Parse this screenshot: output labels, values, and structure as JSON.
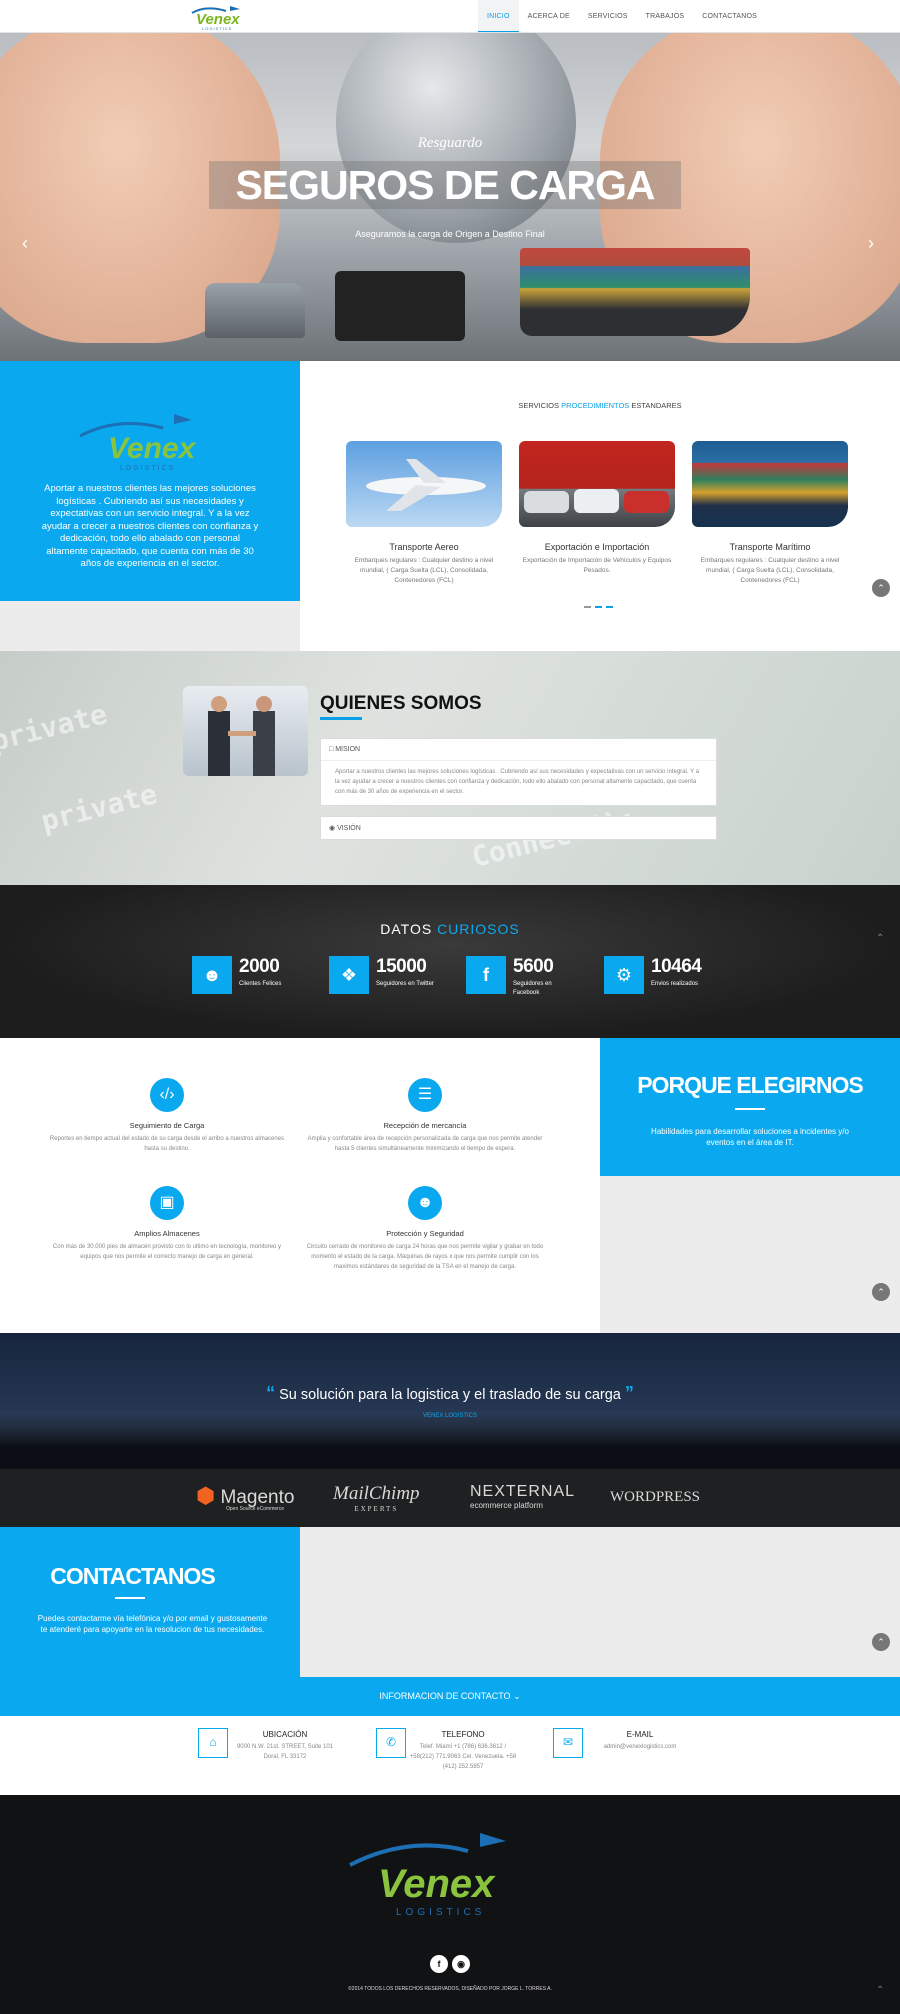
{
  "nav": {
    "logo_text": "Venex",
    "logo_sub": "LOGISTICS",
    "items": [
      "INICIO",
      "ACERCA DE",
      "SERVICIOS",
      "TRABAJOS",
      "CONTACTANOS"
    ]
  },
  "hero": {
    "subtitle": "Resguardo",
    "title": "SEGUROS DE CARGA",
    "caption": "Aseguramos la carga de Origen a Destino Final",
    "prev_icon": "chevron-left-icon",
    "next_icon": "chevron-right-icon"
  },
  "services": {
    "intro": "Aportar a nuestros clientes las mejores soluciones logísticas . Cubriendo así sus necesidades y expectativas con un servicio integral. Y a la vez ayudar a crecer a nuestros clientes con confianza y dedicación, todo ello abalado con personal altamente capacitado, que cuenta con más de 30 años de experiencia en el sector.",
    "heading_pre": "SERVICIOS ",
    "heading_accent": "PROCEDIMIENTOS",
    "heading_post": " ESTANDARES",
    "cards": [
      {
        "title": "Transporte Aereo",
        "desc": "Embarques regulares : Cualquier destino a nivel mundial, ( Carga Suelta (LCL), Consolidada, Contenedores (FCL)"
      },
      {
        "title": "Exportación e Importación",
        "desc": "Exportación de Importación de Vehículos y Equipos Pesados."
      },
      {
        "title": "Transporte Marítimo",
        "desc": "Embarques regulares : Cualquier destino a nivel mundial, ( Carga Suelta (LCL), Consolidada, Contenedores (FCL)"
      }
    ]
  },
  "about": {
    "title": "QUIENES SOMOS",
    "mission_label": "MISION",
    "mission_text": "Aportar a nuestros clientes las mejores soluciones logísticas . Cubriendo así sus necesidades y expectativas con un servicio integral. Y a la vez ayudar a crecer a nuestros clientes con confianza y dedicación, todo ello abalado con personal altamente capacitado, que cuenta con más de 30 años de experiencia en el sector.",
    "vision_label": "VISIÓN"
  },
  "stats": {
    "title_pre": "DATOS ",
    "title_accent": "CURIOSOS",
    "items": [
      {
        "value": "2000",
        "label": "Clientes Felices",
        "icon": "users-icon"
      },
      {
        "value": "15000",
        "label": "Seguidores en Twitter",
        "icon": "twitter-icon"
      },
      {
        "value": "5600",
        "label": "Seguidores en Facebook",
        "icon": "facebook-icon"
      },
      {
        "value": "10464",
        "label": "Envios realizados",
        "icon": "gears-icon"
      }
    ]
  },
  "why": {
    "title": "PORQUE ELEGIRNOS",
    "subtitle": "Habilidades para desarrollar soluciones a incidentes y/o eventos en el área de IT.",
    "features": [
      {
        "title": "Seguimiento de Carga",
        "desc": "Reportes en tiempo actual del estado de su carga desde el arribo a nuestros almacenes hasta su destino.",
        "icon": "code-icon"
      },
      {
        "title": "Recepción de mercancía",
        "desc": "Amplia y confortable área de recepción personalizada de carga que nos permite atender hasta 5 clientes simultáneamente minimizando el tiempo de espera.",
        "icon": "database-icon"
      },
      {
        "title": "Amplios Almacenes",
        "desc": "Con más de 30.000 pies de almacén provisto con lo ultimo en tecnología, monitoreo y equipos que nos permite el correcto manejo de carga en general.",
        "icon": "monitor-icon"
      },
      {
        "title": "Protección y Seguridad",
        "desc": "Circuito cerrado de monitoreo de carga 24 horas que nos permite vigilar y grabar en todo momento el estado de la carga. Máquinas de rayos x que nos permite cumplir con los maximos estándares de seguridad de la TSA en el manejo de carga.",
        "icon": "users-icon"
      }
    ]
  },
  "testimonial": {
    "quote": "Su solución para la logistica y el traslado de su carga",
    "author": "VENEX LOGISTICS"
  },
  "brands": [
    "Magento",
    "Open Source eCommerce",
    "MailChimp",
    "EXPERTS",
    "NEXTERNAL",
    "ecommerce platform",
    "WORDPRESS"
  ],
  "contact": {
    "title": "CONTACTANOS",
    "subtitle": "Puedes contactarme vía telefónica y/o por email y gustosamente te atenderé para apoyarte en la resolucion de tus necesidades.",
    "bar_label": "INFORMACION DE CONTACTO",
    "location_title": "UBICACIÓN",
    "location_text": "9000 N.W. 21st. STREET, Suite 101 Doral, FL 33172",
    "phone_title": "TELEFONO",
    "phone_text": "Telef. Miami +1 (786) 636.3612 / +58(212) 771.9063 Cel. Venezuela. +58 (412) 252.5857",
    "email_title": "E-MAIL",
    "email_text": "admin@venexlogistics.com"
  },
  "footer": {
    "logo_text": "Venex",
    "logo_sub": "LOGISTICS",
    "copyright": "©2014 TODOS LOS DERECHOS RESERVADOS, DISEÑADO POR JORGE L. TORRES A."
  }
}
